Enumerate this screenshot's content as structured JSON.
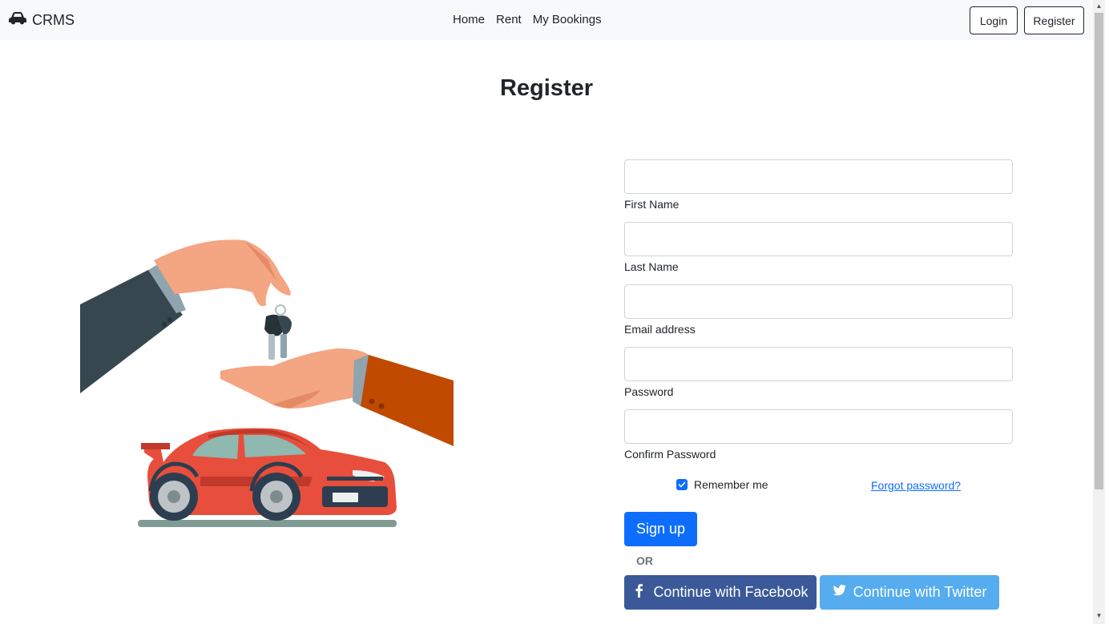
{
  "navbar": {
    "brand": "CRMS",
    "links": [
      "Home",
      "Rent",
      "My Bookings"
    ],
    "login_label": "Login",
    "register_label": "Register"
  },
  "page": {
    "title": "Register"
  },
  "form": {
    "fields": [
      {
        "label": "First Name",
        "value": ""
      },
      {
        "label": "Last Name",
        "value": ""
      },
      {
        "label": "Email address",
        "value": ""
      },
      {
        "label": "Password",
        "value": ""
      },
      {
        "label": "Confirm Password",
        "value": ""
      }
    ],
    "remember_label": "Remember me",
    "remember_checked": true,
    "forgot_label": "Forgot password?",
    "signup_label": "Sign up",
    "or_label": "OR",
    "facebook_label": "Continue with Facebook",
    "twitter_label": "Continue with Twitter"
  },
  "colors": {
    "primary": "#0d6efd",
    "facebook": "#3b5998",
    "twitter": "#55acee",
    "navbar_bg": "#f8f9fa"
  },
  "icons": {
    "brand": "car-icon",
    "facebook": "facebook-icon",
    "twitter": "twitter-icon",
    "checkbox": "check-icon"
  }
}
